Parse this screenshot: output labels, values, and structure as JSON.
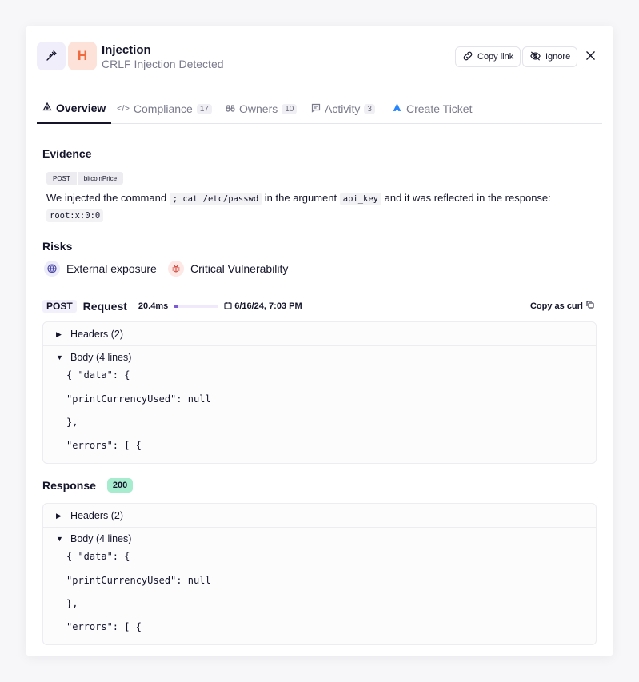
{
  "header": {
    "title": "Injection",
    "subtitle": "CRLF Injection Detected",
    "severity_letter": "H",
    "tool_icon": "syringe-icon",
    "copy_link_label": "Copy link",
    "ignore_label": "Ignore"
  },
  "tabs": [
    {
      "label": "Overview",
      "count": null
    },
    {
      "label": "Compliance",
      "count": "17"
    },
    {
      "label": "Owners",
      "count": "10"
    },
    {
      "label": "Activity",
      "count": "3"
    },
    {
      "label": "Create Ticket",
      "count": null
    }
  ],
  "evidence": {
    "heading": "Evidence",
    "method": "POST",
    "endpoint": "bitcoinPrice",
    "text_1": "We injected the command",
    "command": "; cat /etc/passwd",
    "text_2": "in the argument",
    "argument": "api_key",
    "text_3": "and it was reflected in the response:",
    "reflected": "root:x:0:0"
  },
  "risks": {
    "heading": "Risks",
    "items": [
      "External exposure",
      "Critical Vulnerability"
    ]
  },
  "request": {
    "method": "POST",
    "title": "Request",
    "duration": "20.4ms",
    "duration_fraction": 0.1,
    "date": "6/16/24, 7:03 PM",
    "copy_curl": "Copy as curl",
    "headers_label": "Headers (2)",
    "body_label": "Body (4 lines)",
    "body_lines": [
      "{ \"data\": {",
      "\"printCurrencyUsed\": null",
      "},",
      "\"errors\": [ {"
    ]
  },
  "response": {
    "title": "Response",
    "status": "200",
    "headers_label": "Headers (2)",
    "body_label": "Body (4 lines)",
    "body_lines": [
      "{ \"data\": {",
      "\"printCurrencyUsed\": null",
      "},",
      "\"errors\": [ {"
    ]
  },
  "colors": {
    "severity_high": "#f06a3f",
    "accent_purple": "#7c5cd6",
    "status_ok": "#a8eccf",
    "jira_blue": "#2684ff"
  }
}
